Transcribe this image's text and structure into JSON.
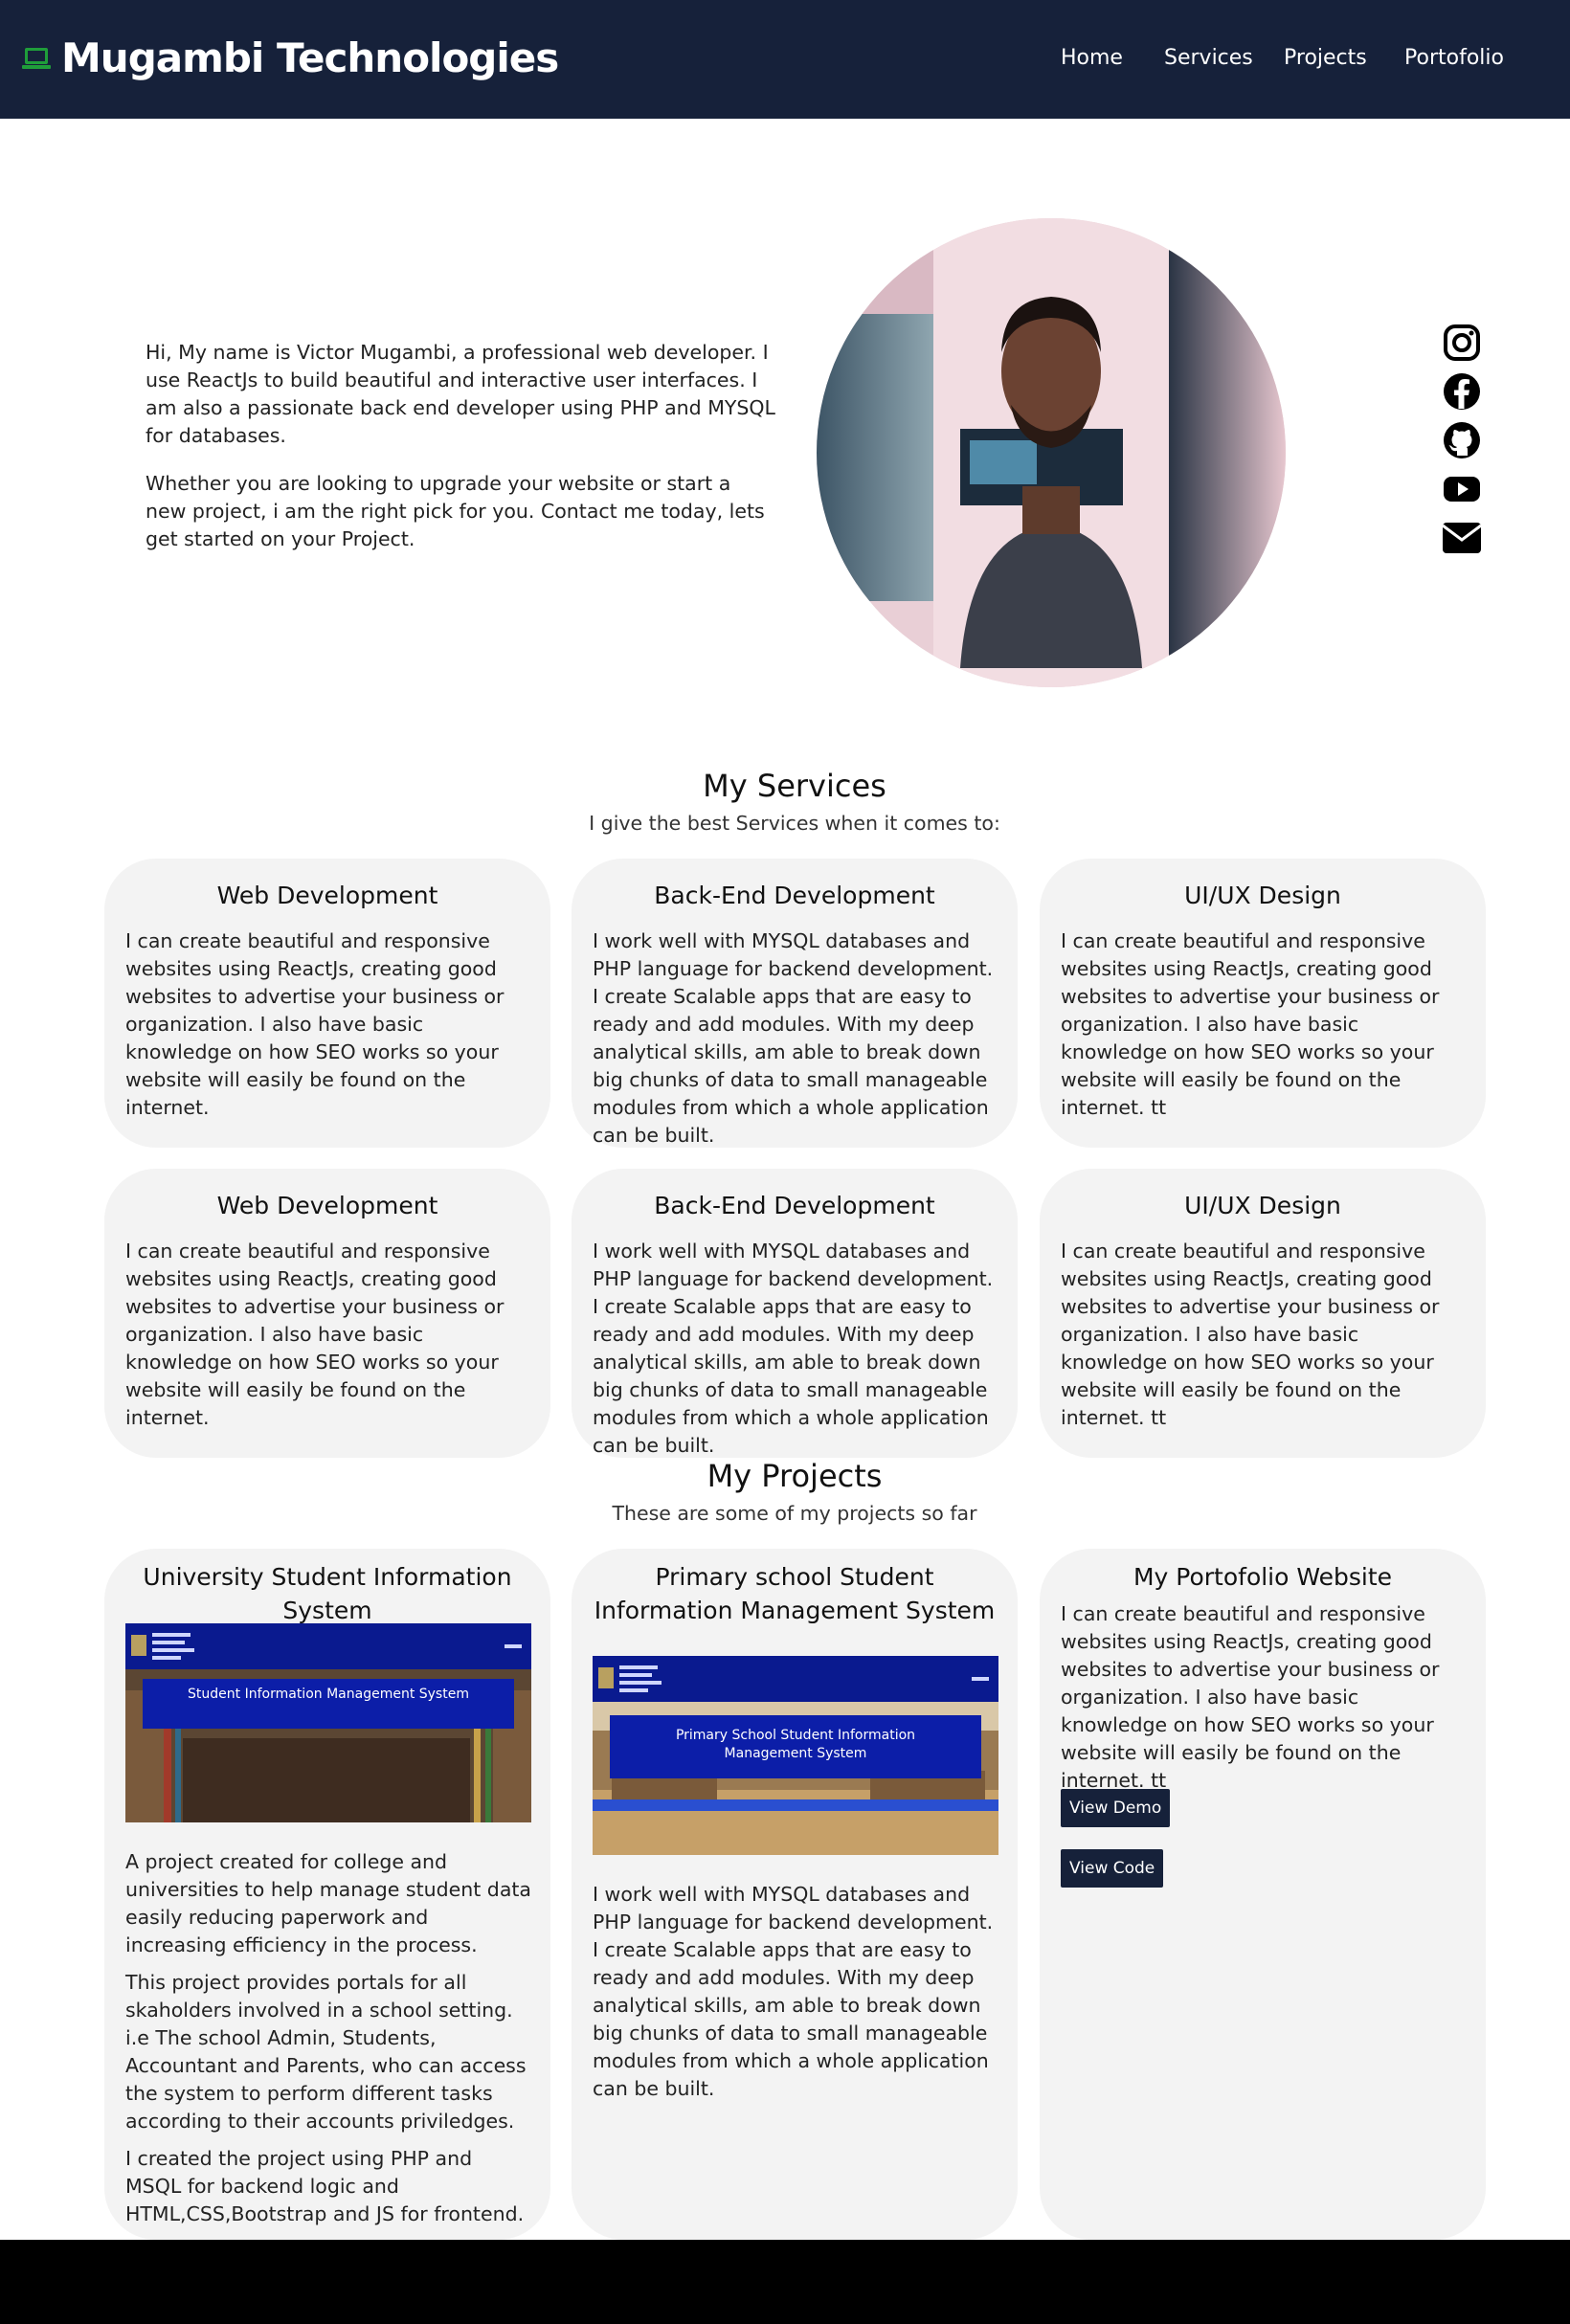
{
  "header": {
    "brand_icon": "laptop-icon",
    "brand_title": "Mugambi Technologies",
    "nav": [
      "Home",
      "Services",
      "Projects",
      "Portofolio"
    ]
  },
  "hero": {
    "paragraphs": [
      "Hi, My name is Victor Mugambi, a professional web developer. I use ReactJs to build beautiful and interactive user interfaces. I am also a passionate back end developer using PHP and MYSQL for databases.",
      "Whether you are looking to upgrade your website or start a new project, i am the right pick for you. Contact me today, lets get started on your Project."
    ]
  },
  "social": [
    "instagram-icon",
    "facebook-icon",
    "github-icon",
    "youtube-icon",
    "email-icon"
  ],
  "services": {
    "title": "My Services",
    "subtitle": "I give the best Services when it comes to:",
    "cards": [
      {
        "title": "Web Development",
        "body": "I can create beautiful and responsive websites using ReactJs, creating good websites to advertise your business or organization. I also have basic knowledge on how SEO works so your website will easily be found on the internet."
      },
      {
        "title": "Back-End Development",
        "body": "I work well with MYSQL databases and PHP language for backend development. I create Scalable apps that are easy to ready and add modules. With my deep analytical skills, am able to break down big chunks of data to small manageable modules from which a whole application can be built."
      },
      {
        "title": "UI/UX Design",
        "body": "I can create beautiful and responsive websites using ReactJs, creating good websites to advertise your business or organization. I also have basic knowledge on how SEO works so your website will easily be found on the internet. tt"
      },
      {
        "title": "Web Development",
        "body": "I can create beautiful and responsive websites using ReactJs, creating good websites to advertise your business or organization. I also have basic knowledge on how SEO works so your website will easily be found on the internet."
      },
      {
        "title": "Back-End Development",
        "body": "I work well with MYSQL databases and PHP language for backend development. I create Scalable apps that are easy to ready and add modules. With my deep analytical skills, am able to break down big chunks of data to small manageable modules from which a whole application can be built."
      },
      {
        "title": "UI/UX Design",
        "body": "I can create beautiful and responsive websites using ReactJs, creating good websites to advertise your business or organization. I also have basic knowledge on how SEO works so your website will easily be found on the internet. tt"
      }
    ]
  },
  "projects": {
    "title": "My Projects",
    "subtitle": "These are some of my projects so far",
    "items": [
      {
        "title": "University Student Information System",
        "screenshot_banner": "Student Information Management System",
        "paragraphs": [
          "A project created for college and universities to help manage student data easily reducing paperwork and increasing efficiency in the process.",
          "This project provides portals for all skaholders involved in a school setting. i.e The school Admin, Students, Accountant and Parents, who can access the system to perform different tasks according to their accounts priviledges.",
          "I created the project using PHP and MSQL for backend logic and HTML,CSS,Bootstrap and JS for frontend."
        ]
      },
      {
        "title": "Primary school Student Information Management System",
        "screenshot_banner": "Primary School Student Information Management System",
        "paragraphs": [
          "I work well with MYSQL databases and PHP language for backend development. I create Scalable apps that are easy to ready and add modules. With my deep analytical skills, am able to break down big chunks of data to small manageable modules from which a whole application can be built."
        ]
      },
      {
        "title": "My Portofolio Website",
        "paragraphs": [
          "I can create beautiful and responsive websites using ReactJs, creating good websites to advertise your business or organization. I also have basic knowledge on how SEO works so your website will easily be found on the internet. tt"
        ],
        "buttons": [
          "View Demo",
          "View Code"
        ]
      }
    ]
  },
  "colors": {
    "header_bg": "#16213a",
    "brand_icon": "#1f9d3a",
    "card_bg": "#f3f3f3",
    "button_bg": "#16213a",
    "footer_bg": "#000000"
  }
}
